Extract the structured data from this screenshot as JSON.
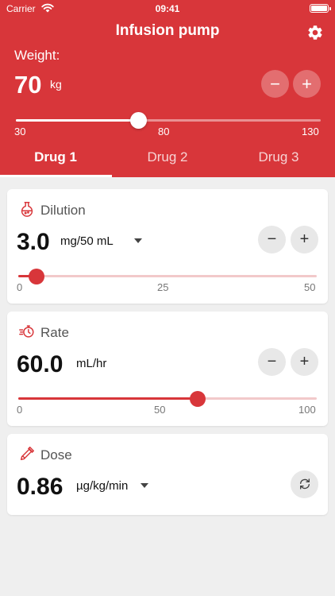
{
  "status_bar": {
    "carrier": "Carrier",
    "time": "09:41"
  },
  "header": {
    "title": "Infusion pump",
    "settings_icon": "gear-icon",
    "background": "#d8363a"
  },
  "weight": {
    "label": "Weight:",
    "value": "70",
    "unit": "kg",
    "min_label": "30",
    "mid_label": "80",
    "max_label": "130",
    "level": 0.4,
    "decrement": "−",
    "increment": "+"
  },
  "tabs": [
    {
      "label": "Drug 1",
      "active": true
    },
    {
      "label": "Drug 2",
      "active": false
    },
    {
      "label": "Drug 3",
      "active": false
    }
  ],
  "dilution": {
    "title": "Dilution",
    "icon": "flask-icon",
    "value": "3.0",
    "unit": "mg/50 mL",
    "min_label": "0",
    "mid_label": "25",
    "max_label": "50",
    "level": 0.06,
    "decrement": "−",
    "increment": "+"
  },
  "rate": {
    "title": "Rate",
    "icon": "stopwatch-icon",
    "value": "60.0",
    "unit": "mL/hr",
    "min_label": "0",
    "mid_label": "50",
    "max_label": "100",
    "level": 0.6,
    "decrement": "−",
    "increment": "+"
  },
  "dose": {
    "title": "Dose",
    "icon": "dropper-icon",
    "value": "0.86",
    "unit": "µg/kg/min",
    "refresh_icon": "refresh-icon"
  }
}
